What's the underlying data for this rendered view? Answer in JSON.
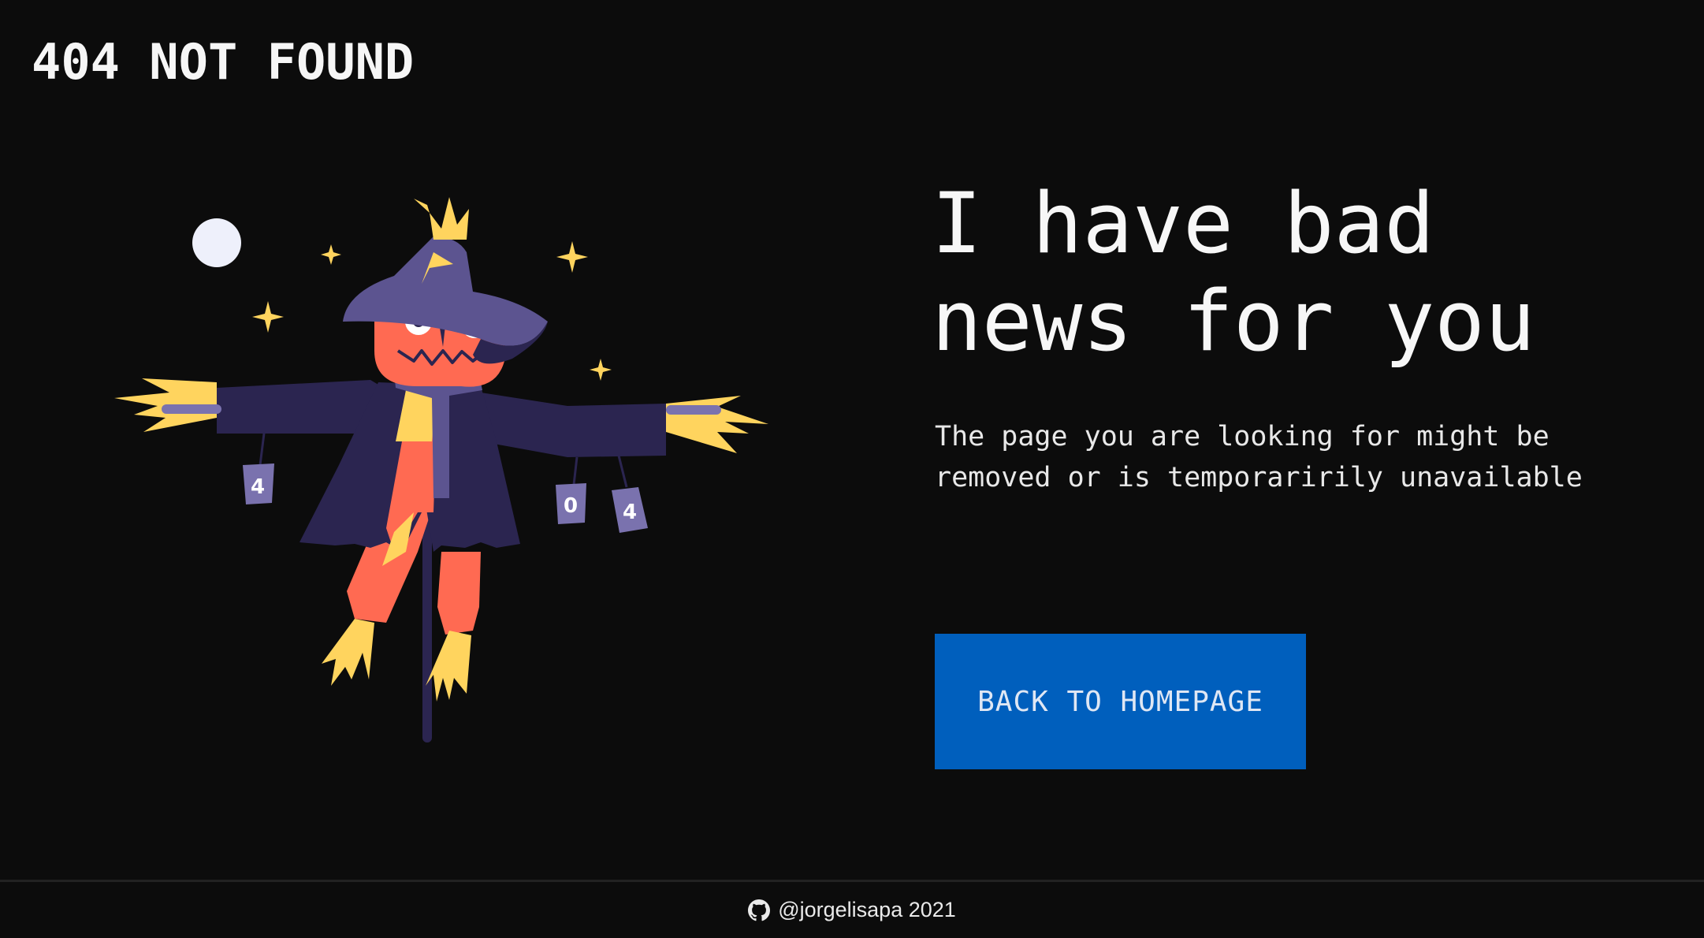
{
  "header": {
    "brand": "404 NOT FOUND"
  },
  "main": {
    "headline_line1": "I have bad",
    "headline_line2": "news for you",
    "description": "The page you are looking for might be removed or is temporaririly unavailable",
    "cta_label": "BACK TO HOMEPAGE"
  },
  "illustration": {
    "can_labels": [
      "4",
      "0",
      "4"
    ],
    "icon": "scarecrow-illustration"
  },
  "footer": {
    "icon": "github-icon",
    "credit": "@jorgelisapa 2021"
  },
  "colors": {
    "background": "#0c0c0c",
    "button": "#005fbd",
    "text": "#f1f1f1",
    "scarecrow_body": "#2b2550",
    "scarecrow_hat": "#5c5490",
    "scarecrow_face": "#ff6a52",
    "straw": "#ffd45e",
    "moon": "#eef0fb"
  }
}
